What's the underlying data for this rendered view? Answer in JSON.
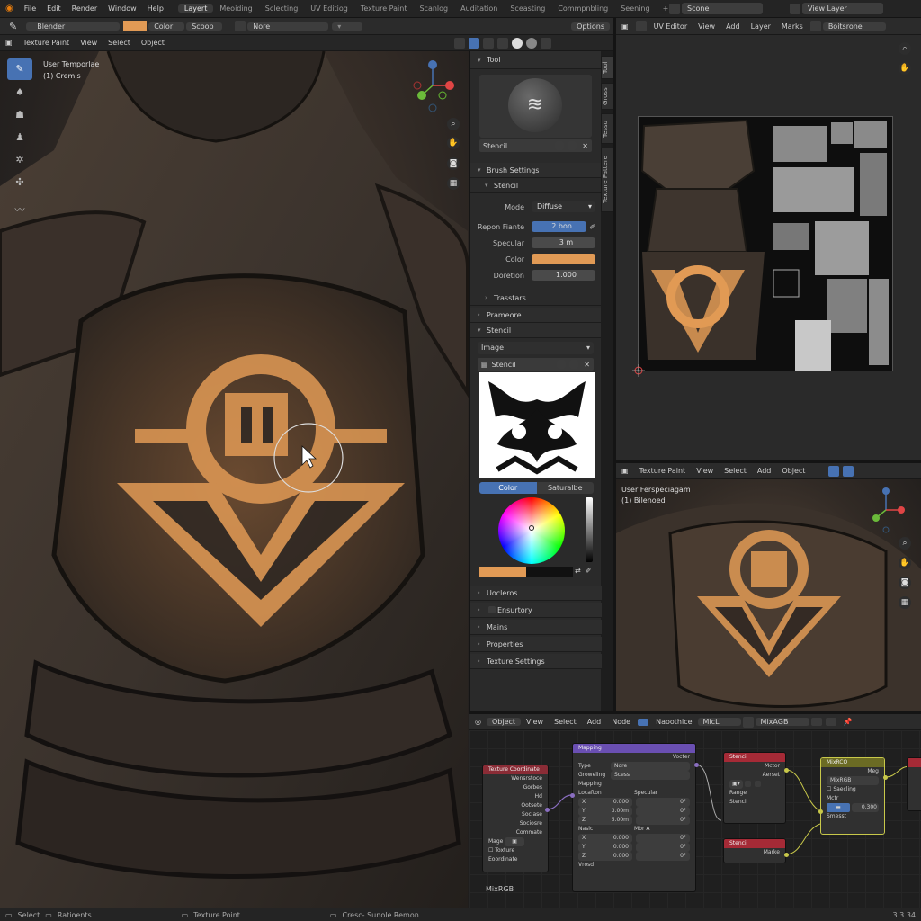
{
  "menu": [
    "File",
    "Edit",
    "Render",
    "Window",
    "Help"
  ],
  "workspaces": [
    "Layert",
    "Meoiding",
    "Sclecting",
    "UV Editiog",
    "Texture Paint",
    "Scanlog",
    "Auditation",
    "Sceasting",
    "Commpnbling",
    "Seening"
  ],
  "active_workspace": "Layert",
  "scene": "Scone",
  "view_layer": "View Layer",
  "tool_header": {
    "brush_name": "Blender",
    "color_label": "Color",
    "scope_label": "Scoop",
    "none_label": "Nore",
    "options": "Options"
  },
  "viewport_header": {
    "mode": "Texture Paint",
    "items": [
      "View",
      "Select",
      "Object"
    ]
  },
  "viewport_overlay": {
    "line1": "User Temporlae",
    "line2": "(1) Cremis"
  },
  "uv_header": {
    "title": "UV Editor",
    "items": [
      "View",
      "Add",
      "Layer",
      "Marks"
    ],
    "image": "Boitsrone"
  },
  "tool_panel": {
    "title": "Tool",
    "brush_label": "Stencil",
    "brush_settings": "Brush Settings",
    "stencil_sub": "Stencil",
    "mode_label": "Mode",
    "mode_value": "Diffuse",
    "rep_label": "Repon Fiante",
    "rep_value": "2 bon",
    "spec_label": "Specular",
    "spec_value": "3 m",
    "color_label": "Color",
    "dens_label": "Doretion",
    "dens_value": "1.000",
    "transfers": "Trasstars",
    "framee": "Prameore",
    "stencil_sect": "Stencil",
    "image_drop": "Image",
    "image_name": "Stencil",
    "tab_color": "Color",
    "tab_sat": "Saturalbe",
    "bottom_sections": [
      "Uocleros",
      "Ensurtory",
      "Mains",
      "Properties",
      "Texture Settings"
    ]
  },
  "side_tabs": [
    "Tool",
    "Gross",
    "Tessu",
    "Texture Pattere"
  ],
  "viewport2_header": {
    "mode": "Texture Paint",
    "items": [
      "View",
      "Select",
      "Add",
      "Object"
    ]
  },
  "viewport2_overlay": {
    "line1": "User Ferspeciagam",
    "line2": "(1) Bilenoed"
  },
  "node_header": {
    "mode": "Object",
    "items": [
      "View",
      "Select",
      "Add",
      "Node"
    ],
    "slot": "Naoothice",
    "mat": "MicL",
    "name": "MixAGB"
  },
  "nodes": {
    "tex_coord": {
      "title": "Texture Coordinate",
      "outputs": [
        "Wensrstoce",
        "Gorbes",
        "Hd",
        "Ootsete",
        "Sociase",
        "Sociosre",
        "Commate"
      ],
      "image_label": "Mage",
      "check_label": "Toxture Eoordinate"
    },
    "mapping": {
      "title": "Mapping",
      "out": "Vocter",
      "type_label": "Type",
      "type_val": "Nore",
      "grouping_label": "Groweling",
      "grouping_val": "Scess",
      "mapping_label": "Mapping",
      "loc_label": "Locafton",
      "rot_label": "Specular",
      "vals_a": [
        "X",
        "Y",
        "Z"
      ],
      "loc_vals": [
        "0.000",
        "3.00m",
        "5.00m"
      ],
      "rot_vals": [
        "0°",
        "0°",
        "0°"
      ],
      "scale_label": "Nasic",
      "max_label": "Mbr A",
      "scale_vals": [
        "0.000",
        "0.000",
        "0.000"
      ],
      "max_vals": [
        "0°",
        "0°",
        "0°"
      ],
      "foot": "Vrosd"
    },
    "stencil1": {
      "title": "Stencil",
      "rows": [
        "Mctor",
        "Aerset"
      ],
      "in1": "Range",
      "in2": "Stencil"
    },
    "stencil2": {
      "title": "Stencil",
      "out": "Marke"
    },
    "mixrgb": {
      "title": "MixRCO",
      "out": "Meg",
      "mode": "MixRGB",
      "check": "Saecling",
      "row": "Mctr",
      "fac": "0.300",
      "foot": "Smesst"
    },
    "footer": "MixRGB"
  },
  "status": {
    "select": "Select",
    "rotate": "Ratioents",
    "mode": "Texture Point",
    "hint": "Cresc- Sunole Remon",
    "version": "3.3.34"
  },
  "colors": {
    "accent": "#4772b3",
    "orange": "#e19a55",
    "workspace_active": "#3a3a3a"
  }
}
